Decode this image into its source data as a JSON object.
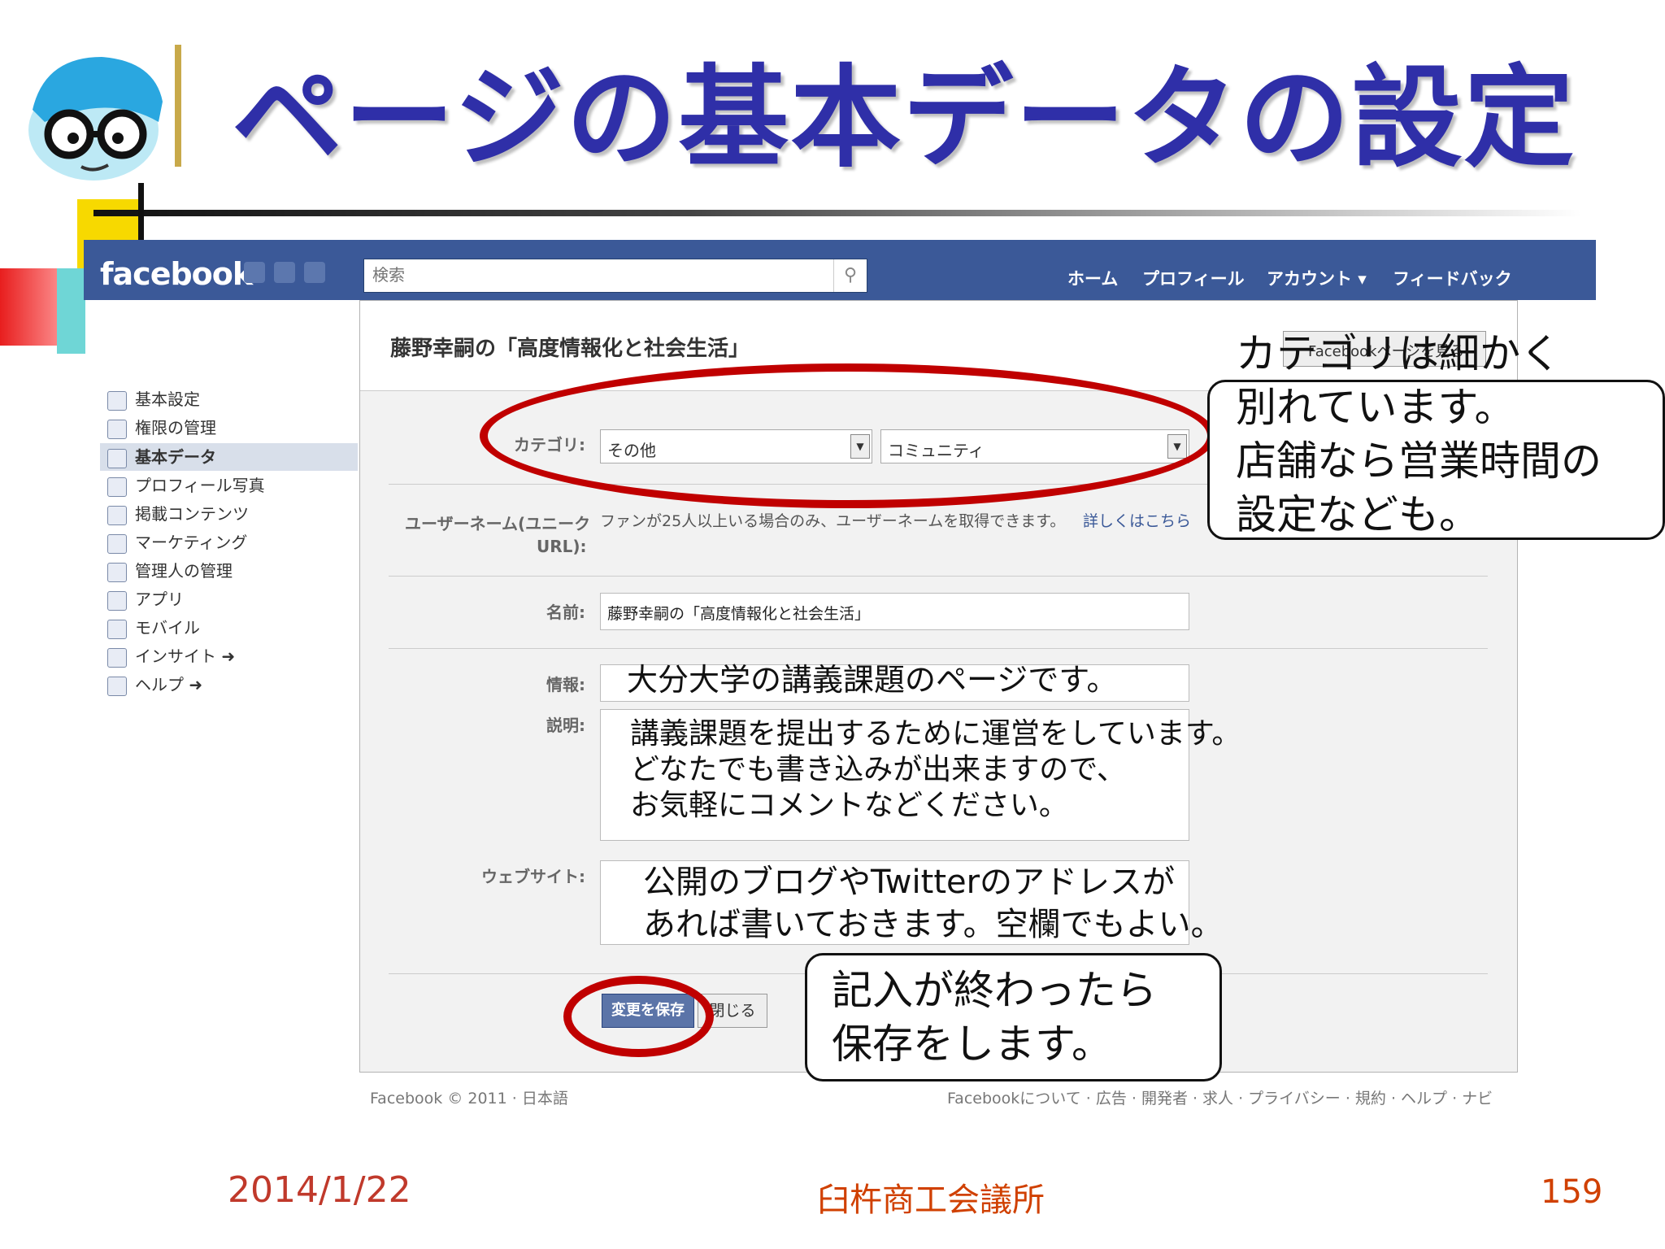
{
  "slide": {
    "title": "ページの基本データの設定",
    "date": "2014/1/22",
    "organization": "臼杵商工会議所",
    "page_number": "159"
  },
  "facebook": {
    "logo": "facebook",
    "search_placeholder": "検索",
    "nav": [
      "ホーム",
      "プロフィール",
      "アカウント ▾",
      "フィードバック"
    ],
    "page_title": "藤野幸嗣の「高度情報化と社会生活」",
    "fb_page_button": "Facebookページを見る",
    "sidebar": [
      {
        "label": "基本設定"
      },
      {
        "label": "権限の管理"
      },
      {
        "label": "基本データ"
      },
      {
        "label": "プロフィール写真"
      },
      {
        "label": "掲載コンテンツ"
      },
      {
        "label": "マーケティング"
      },
      {
        "label": "管理人の管理"
      },
      {
        "label": "アプリ"
      },
      {
        "label": "モバイル"
      },
      {
        "label": "インサイト ➜"
      },
      {
        "label": "ヘルプ ➜"
      }
    ],
    "sidebar_active_index": 2,
    "form": {
      "category_label": "カテゴリ:",
      "category_value": "その他",
      "subcategory_value": "コミュニティ",
      "username_label_1": "ユーザーネーム(ユニーク",
      "username_label_2": "URL):",
      "username_note": "ファンが25人以上いる場合のみ、ユーザーネームを取得できます。",
      "username_link": "詳しくはこちら",
      "name_label": "名前:",
      "name_value": "藤野幸嗣の「高度情報化と社会生活」",
      "info_label": "情報:",
      "info_value": "大分大学の講義課題のページです。",
      "description_label": "説明:",
      "description_value": "講義課題を提出するために運営をしています。\nどなたでも書き込みが出来ますので、\nお気軽にコメントなどください。",
      "website_label": "ウェブサイト:",
      "website_value": "公開のブログやTwitterのアドレスが\nあれば書いておきます。空欄でもよい。",
      "save_button": "変更を保存",
      "close_button": "閉じる"
    },
    "footer_left": "Facebook © 2011 · 日本語",
    "footer_right": "Facebookについて · 広告 · 開発者 · 求人 · プライバシー · 規約 · ヘルプ · ナビ"
  },
  "callouts": {
    "category": "カテゴリは細かく\n別れています。\n店舗なら営業時間の\n設定なども。",
    "save": "記入が終わったら\n保存をします。"
  },
  "colors": {
    "title": "#2f2fa8",
    "facebook_blue": "#3b5998",
    "annotation_red": "#c00000",
    "footer_date": "#c0392b",
    "footer_org": "#d04000"
  }
}
